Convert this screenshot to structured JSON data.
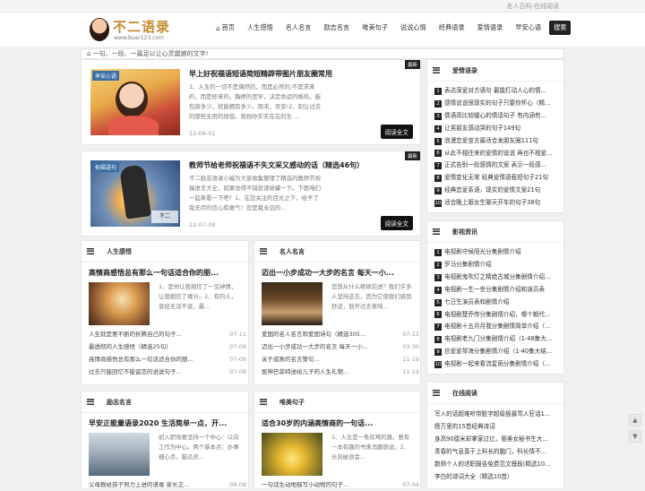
{
  "topbar": {
    "right_text": "名人百科-在线阅读"
  },
  "logo": {
    "title": "不二语录",
    "url": "www.buer123.com"
  },
  "nav": {
    "home": "首页",
    "items": [
      "人生感悟",
      "名人名言",
      "励志名言",
      "唯美句子",
      "说说心情",
      "经典语录",
      "爱情语录",
      "早安心语",
      "搜索"
    ]
  },
  "breadcrumb": "一句、一段、一篇足以让心灵震撼的文字!",
  "articles": [
    {
      "tag": "早安心语",
      "corner": "最新",
      "title": "早上好祝福语短语简短精辟带图片朋友圈常用",
      "desc": "1、人生的一切不是偶然的，而是必然的;不是求来的，而是修来的。胸襟的宽窄，决定命运的格局，能包容多少，就能拥有多少。周末，早安!2、别让过去的那些无用的烦恼，阻挡你实实在在的生 ...",
      "date": "22-08-01",
      "more": "阅读全文"
    },
    {
      "tag": "祝福语句",
      "corner": "最新",
      "title": "教师节给老师祝福语不失文采又感动的话（精选46句）",
      "desc": "不二励志语录小编为大家收集整理了精选的教师节祝福语言大全，如果觉得不错就请收藏一下。下面咱们一起来看一下吧！1、在您关注的目光之下，给予了我无尽的信心和勇气！您是我永远的...",
      "date": "22-07-08",
      "more": "阅读全文"
    }
  ],
  "categories": [
    {
      "name": "人生感悟",
      "feature_title": "高情商感悟总有那么一句话适合你的朋...",
      "feature_desc": "1、是你让我相信了一见钟情，让我相信了缘分。2、有的人，曾经无话不说，最...",
      "items": [
        {
          "t": "人生就是要不断的折腾自己的句子...",
          "d": "07-11"
        },
        {
          "t": "最透彻的人生感悟（精选25句）",
          "d": "07-09"
        },
        {
          "t": "高情商感悟总有那么一句话适合你的朋...",
          "d": "07-09"
        },
        {
          "t": "过去只能回忆不能留恋的说说句子...",
          "d": "07-08"
        }
      ]
    },
    {
      "name": "名人名言",
      "feature_title": "迈出一小步成功一大步的名言 每天一小...",
      "feature_desc": "您想从什么继续前进？我们许多人坚持这去，因为它使我们感到舒适，放开过去意味...",
      "items": [
        {
          "t": "爱国的名人名言和爱国诗句（精选305...",
          "d": "07-12"
        },
        {
          "t": "迈出一小步成功一大步的名言 每天一小...",
          "d": "03-30"
        },
        {
          "t": "关于成败的名言警句...",
          "d": "11-19"
        },
        {
          "t": "股神巴菲特送给儿子的人生礼物...",
          "d": "11-19"
        }
      ]
    },
    {
      "name": "励志名言",
      "feature_title": "早安正能量语录2020 生活简单一点，开...",
      "feature_desc": "初入职场要坚持一个中心：以向工作为中心。两个基本点：办事细心点，脑瓜灵...",
      "items": [
        {
          "t": "父母教给孩子努力上进的语录 家长正...",
          "d": "08-08"
        }
      ]
    },
    {
      "name": "唯美句子",
      "feature_title": "适合30岁的内涵高情商的一句话...",
      "feature_desc": "1、人生是一条欢莺的路，要有一本有趣的书来消磨旅途。2、长风破浪会...",
      "items": [
        {
          "t": "一句话生动地描写小动物的句子...",
          "d": "07-04"
        }
      ]
    }
  ],
  "side_love": {
    "title": "爱情语录",
    "items": [
      "表达深爱对方语句 最能打动人心的情...",
      "感情说说很现实的句子只要你怀心（精...",
      "情语高比较暖心的情话句子 有内涵有...",
      "让男朋友感动哭的句子149句",
      "浪漫恋爱宣言最适合发朋友圈111句",
      "从此不相往来的爱情的说说 再也不相爱...",
      "正式告别一段感情的文案 表示一段感...",
      "爱情变化无常 经典爱情语惹短句子21句",
      "经典恋爱系语，现实的爱情文案21句",
      "适合晚上跟女生聊天开车的句子38句"
    ]
  },
  "side_film": {
    "title": "影视资讯",
    "items": [
      "电视剧守候阳光分集剧情介绍",
      "罗马分集剧情介绍",
      "电视剧鬼吹灯之精绝古城分集剧情介绍...",
      "电视剧一生一世分集剧情介绍和演员表",
      "七日生演员表和剧情介绍",
      "电视剧楚乔传分集剧情介绍，哪个朝代...",
      "电视剧十五月月我分集剧情简单介绍（...",
      "电视剧老九门分集剧情介绍（1-48集大...",
      "信爱爱琴海分集剧情介绍（1-40集大结...",
      "电视剧一起来看流星雨分集剧情介绍（..."
    ]
  },
  "side_read": {
    "title": "在线阅读",
    "items": [
      "写人的话超难听带脏字超级狠暴骂人狂话1...",
      "杨万里的15首经典诗词",
      "身高90厘米却拿家过亿，娶美女秘书生大...",
      "青春的气息喜于上科长的脑门，科长情不...",
      "数师个人的述职报告免费范文模板(精选10...",
      "李白的诗词大全（精选10首）"
    ]
  },
  "floats": [
    "▲",
    "▼"
  ]
}
